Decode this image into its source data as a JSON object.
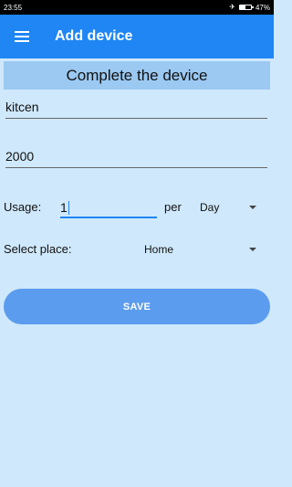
{
  "status_bar": {
    "time": "23:55",
    "battery_text": "47%",
    "battery_level": 0.47
  },
  "app_bar": {
    "title": "Add device",
    "menu_icon": "hamburger-menu-icon"
  },
  "form": {
    "header": "Complete the device",
    "name_value": "kitcen",
    "power_value": "2000",
    "usage_label": "Usage:",
    "usage_value": "1",
    "per_label": "per",
    "period_value": "Day",
    "place_label": "Select place:",
    "place_value": "Home",
    "save_label": "SAVE"
  },
  "colors": {
    "app_bar": "#1f86f4",
    "background": "#cfe8fb",
    "header_bg": "#9bc9f2",
    "save_button": "#5b9cee"
  }
}
